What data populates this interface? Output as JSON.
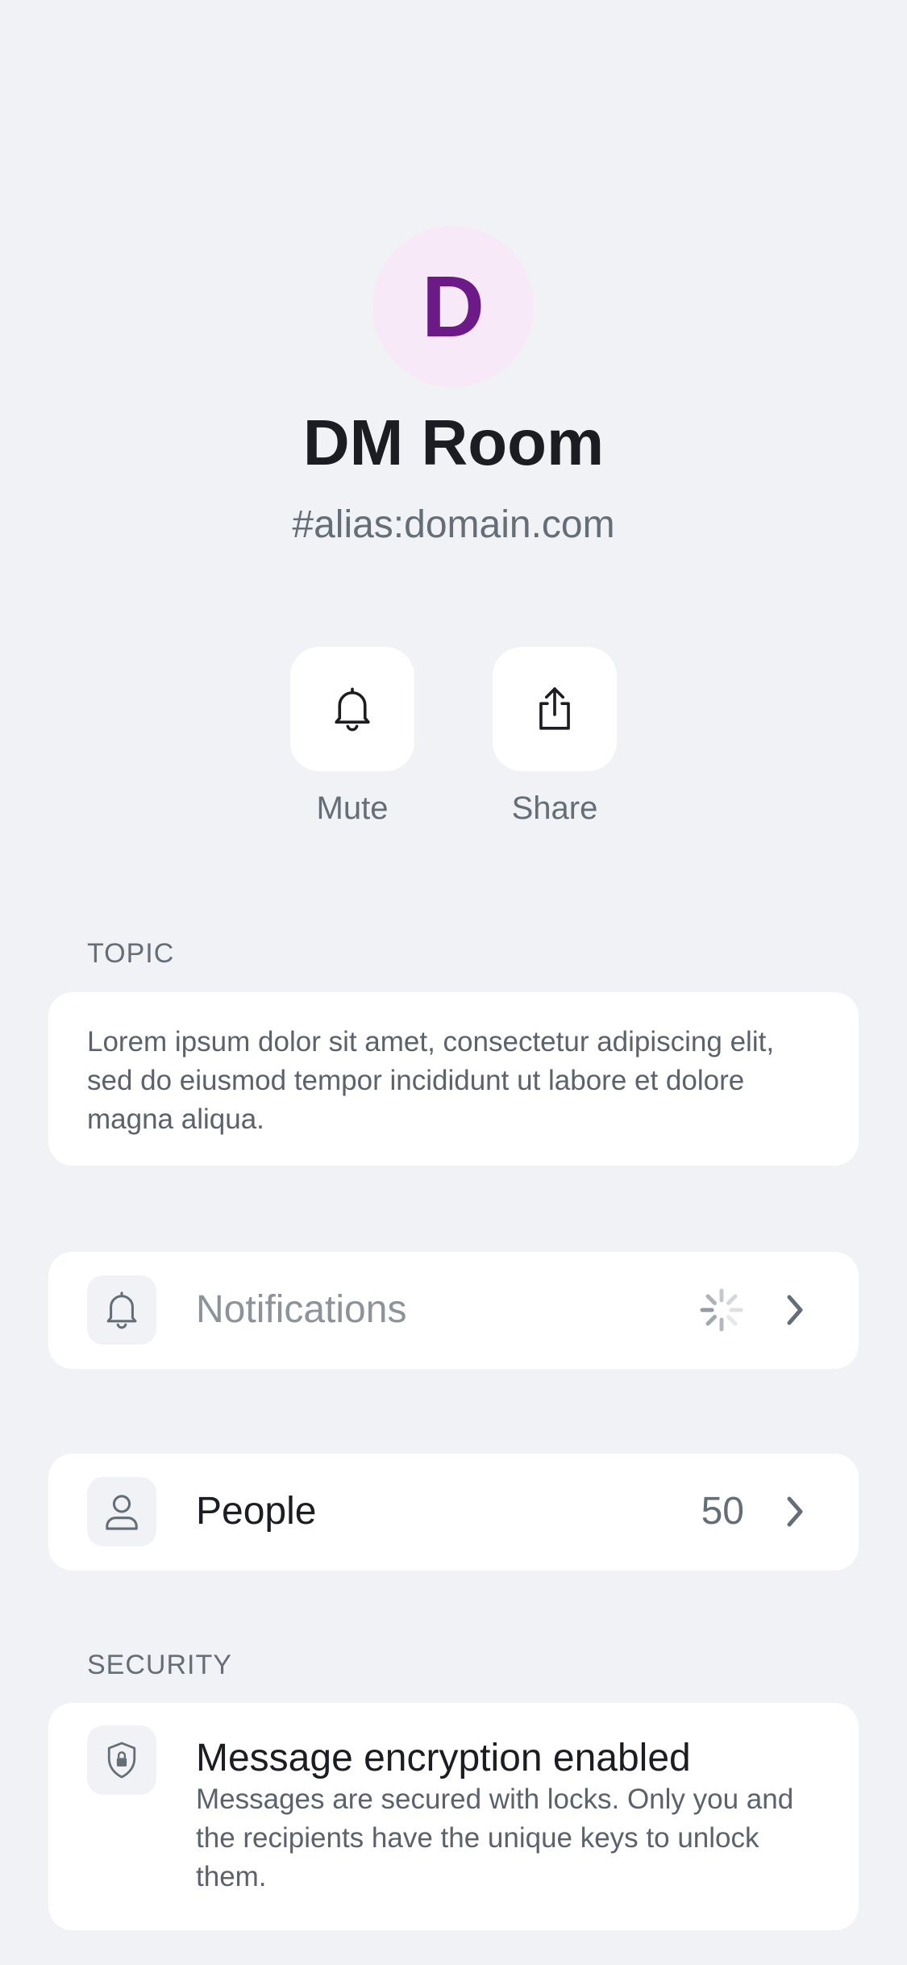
{
  "room": {
    "avatar_letter": "D",
    "name": "DM Room",
    "alias": "#alias:domain.com"
  },
  "actions": [
    {
      "label": "Mute",
      "icon": "bell-icon"
    },
    {
      "label": "Share",
      "icon": "share-icon"
    }
  ],
  "topic": {
    "section_label": "TOPIC",
    "text": "Lorem ipsum dolor sit amet, consectetur adipiscing elit, sed do eiusmod tempor incididunt ut labore et dolore magna aliqua."
  },
  "notifications": {
    "label": "Notifications",
    "icon": "bell-icon",
    "status": "loading-spinner-icon"
  },
  "people": {
    "label": "People",
    "count": "50",
    "icon": "user-icon"
  },
  "security": {
    "section_label": "SECURITY",
    "title": "Message encryption enabled",
    "description": "Messages are secured with locks. Only you and the recipients have the unique keys to unlock them.",
    "icon": "shield-lock-icon"
  },
  "colors": {
    "background": "#f0f2f5",
    "card": "#ffffff",
    "avatar_bg": "#f7e9f7",
    "avatar_letter": "#6c1a87",
    "primary_text": "#1b1d22",
    "secondary_text": "#656d77",
    "disabled_text": "#8d939b"
  }
}
